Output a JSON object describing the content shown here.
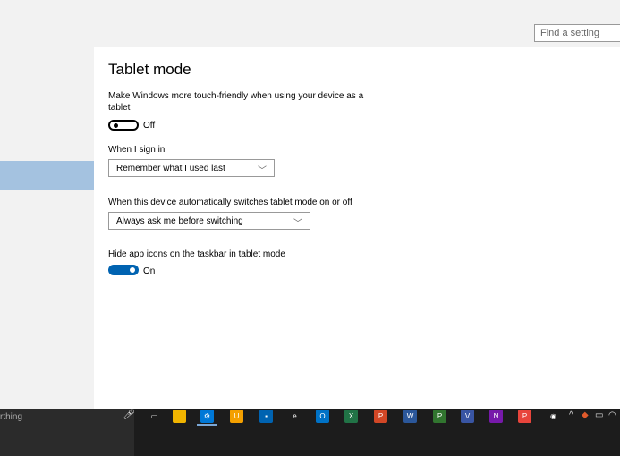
{
  "header": {
    "search_placeholder": "Find a setting"
  },
  "main": {
    "title": "Tablet mode",
    "touch_description": "Make Windows more touch-friendly when using your device as a tablet",
    "touch_toggle_state": "Off",
    "signin_label": "When I sign in",
    "signin_value": "Remember what I used last",
    "switch_label": "When this device automatically switches tablet mode on or off",
    "switch_value": "Always ask me before switching",
    "hide_icons_label": "Hide app icons on the taskbar in tablet mode",
    "hide_icons_state": "On"
  },
  "taskbar": {
    "search_text": "rthing",
    "apps": [
      {
        "name": "task-view",
        "color": "#1c1c1c",
        "glyph": "▭"
      },
      {
        "name": "file-explorer",
        "color": "#f0b400",
        "glyph": ""
      },
      {
        "name": "settings",
        "color": "#0078d7",
        "glyph": "⚙"
      },
      {
        "name": "store",
        "color": "#f4a000",
        "glyph": "U"
      },
      {
        "name": "photos",
        "color": "#0063b1",
        "glyph": "▪"
      },
      {
        "name": "edge",
        "color": "#1c1c1c",
        "glyph": "e"
      },
      {
        "name": "outlook",
        "color": "#0072c6",
        "glyph": "O"
      },
      {
        "name": "excel",
        "color": "#217346",
        "glyph": "X"
      },
      {
        "name": "powerpoint",
        "color": "#d24726",
        "glyph": "P"
      },
      {
        "name": "word",
        "color": "#2b579a",
        "glyph": "W"
      },
      {
        "name": "project",
        "color": "#31752f",
        "glyph": "P"
      },
      {
        "name": "visio",
        "color": "#3955a3",
        "glyph": "V"
      },
      {
        "name": "onenote",
        "color": "#7719aa",
        "glyph": "N"
      },
      {
        "name": "publisher",
        "color": "#e8453c",
        "glyph": "P"
      },
      {
        "name": "groove",
        "color": "#1c1c1c",
        "glyph": "◉"
      }
    ],
    "tray_chevron": "^"
  }
}
